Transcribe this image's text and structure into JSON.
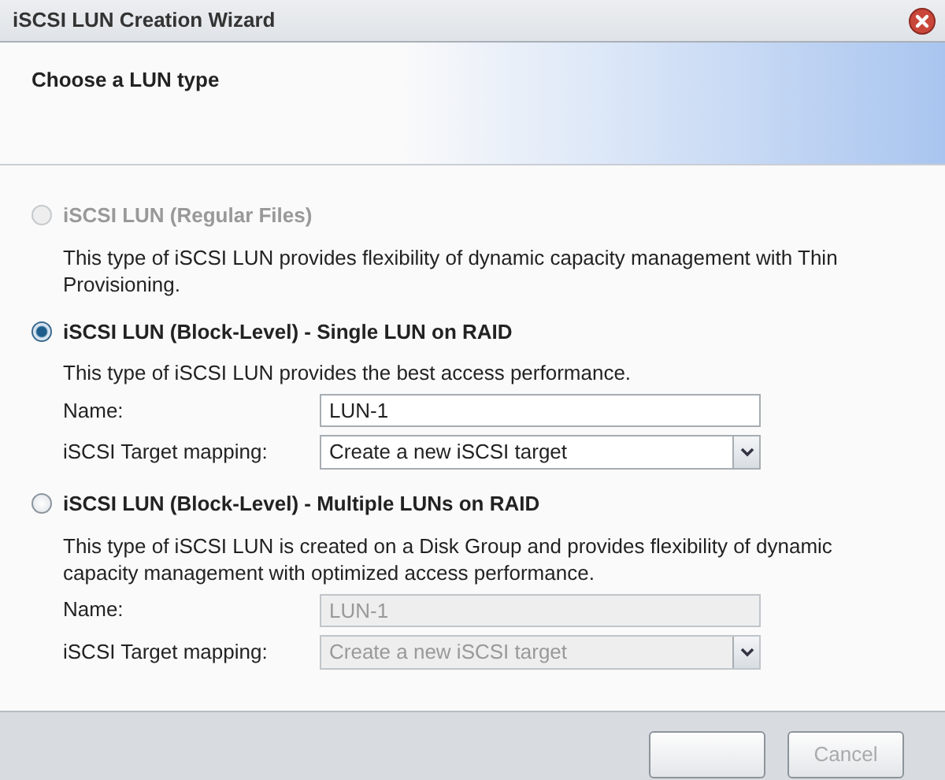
{
  "window": {
    "title": "iSCSI LUN Creation Wizard"
  },
  "header": {
    "title": "Choose a LUN type"
  },
  "options": [
    {
      "label": "iSCSI LUN (Regular Files)",
      "selected": false,
      "disabled": true,
      "description": "This type of iSCSI LUN provides flexibility of dynamic capacity management with Thin Provisioning."
    },
    {
      "label": "iSCSI LUN (Block-Level) - Single LUN on RAID",
      "selected": true,
      "disabled": false,
      "description": "This type of iSCSI LUN provides the best access performance.",
      "fields": [
        {
          "kind": "text",
          "label": "Name:",
          "value": "LUN-1",
          "disabled": false
        },
        {
          "kind": "select",
          "label": "iSCSI Target mapping:",
          "value": "Create a new iSCSI target",
          "disabled": false
        }
      ]
    },
    {
      "label": "iSCSI LUN (Block-Level) - Multiple LUNs on RAID",
      "selected": false,
      "disabled": false,
      "description": "This type of iSCSI LUN is created on a Disk Group and provides flexibility of dynamic capacity management with optimized access performance.",
      "fields": [
        {
          "kind": "text",
          "label": "Name:",
          "value": "LUN-1",
          "disabled": true
        },
        {
          "kind": "select",
          "label": "iSCSI Target mapping:",
          "value": "Create a new iSCSI target",
          "disabled": true
        }
      ]
    }
  ],
  "footer": {
    "buttons": [
      {
        "kind": "blank"
      },
      {
        "kind": "labeled",
        "label": "Cancel"
      }
    ]
  }
}
